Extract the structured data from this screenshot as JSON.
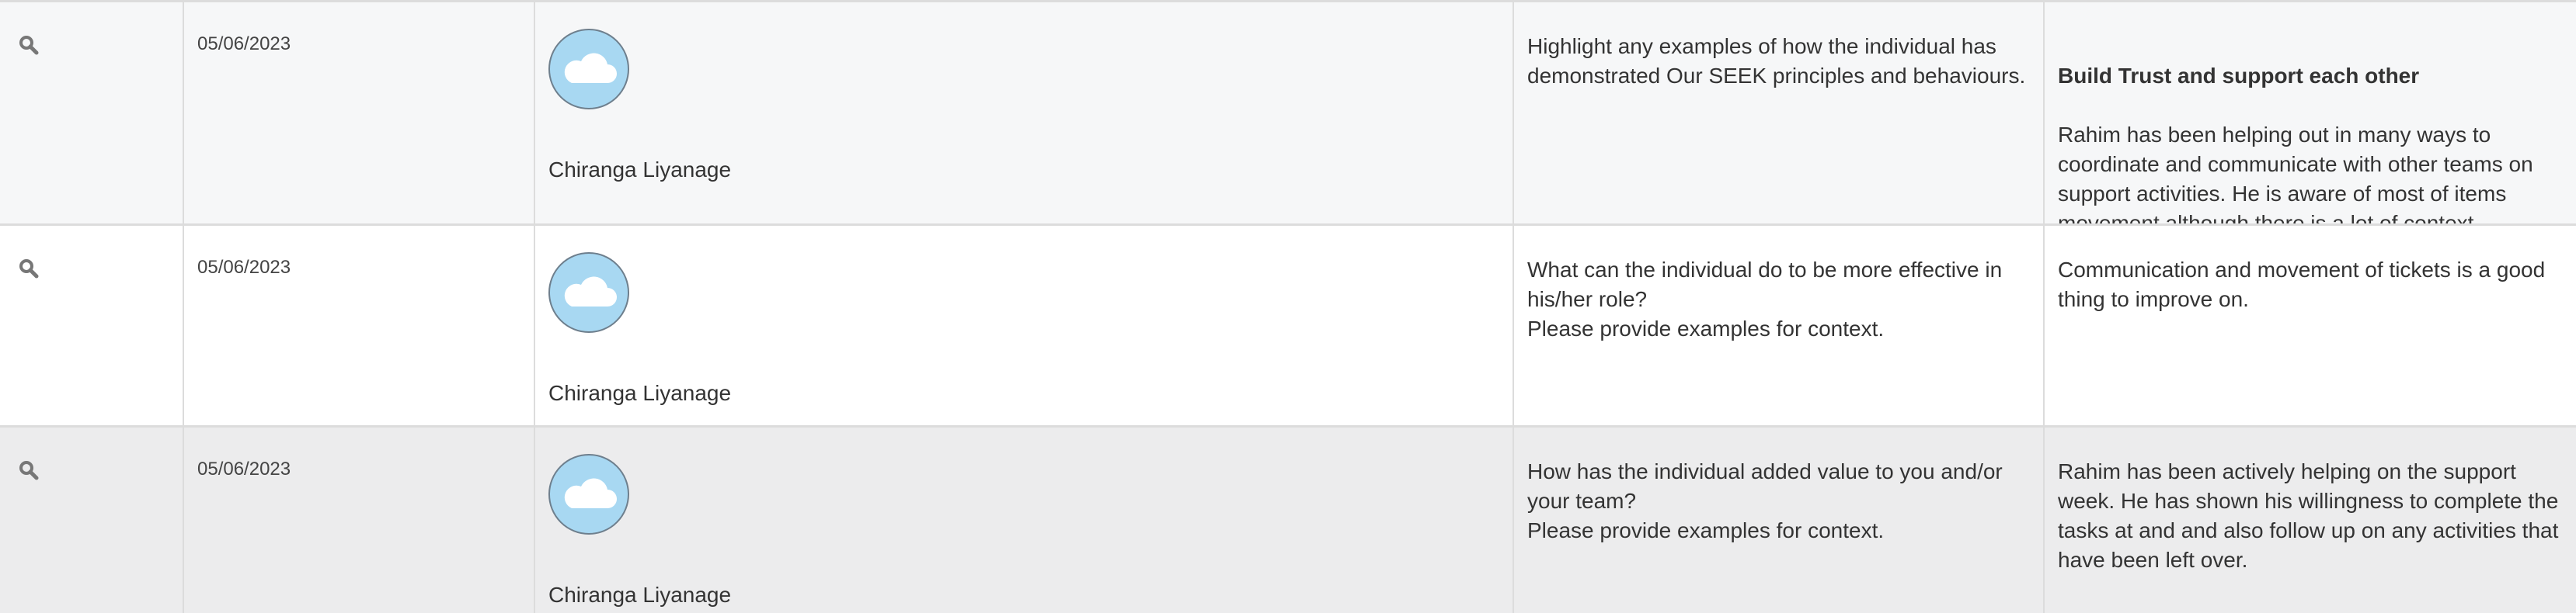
{
  "icons": {
    "view": "magnifier-icon",
    "avatar": "cloud-avatar-icon"
  },
  "colors": {
    "avatar_bg": "#a8d8f2",
    "row_alt": "#ececed",
    "border": "#dcdcdc"
  },
  "rows": [
    {
      "date": "05/06/2023",
      "person": "Chiranga Liyanage",
      "question": "Highlight any examples of how the individual has demonstrated Our SEEK principles and behaviours.",
      "answer_title": "Build Trust and support each other",
      "answer": "Rahim has been helping out in many ways to coordinate and communicate with other teams on support activities. He is aware of most of items movement although there is a lot of context switching."
    },
    {
      "date": "05/06/2023",
      "person": "Chiranga Liyanage",
      "question": "What can the individual do to be more effective in his/her role?\nPlease provide examples for context.",
      "answer": "Communication and movement of tickets is a good thing to improve on."
    },
    {
      "date": "05/06/2023",
      "person": "Chiranga Liyanage",
      "question": "How has the individual added value to you and/or your team?\nPlease provide examples for context.",
      "answer": "Rahim has been actively helping on the support week. He has shown his willingness to complete the tasks at and and also follow up on any activities that have been left over."
    }
  ]
}
